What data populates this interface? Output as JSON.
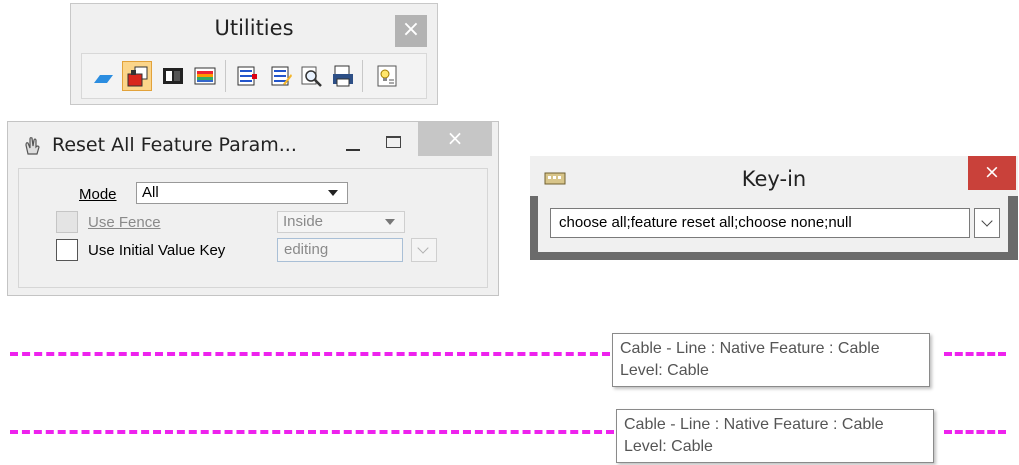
{
  "utilities": {
    "title": "Utilities",
    "close": "×",
    "tools": [
      {
        "icon": "parallelogram-icon"
      },
      {
        "icon": "feature-mode-icon",
        "active": true
      },
      {
        "icon": "panel-icon"
      },
      {
        "icon": "palette-icon"
      },
      {
        "icon": "list-lines-icon"
      },
      {
        "icon": "list-edit-icon"
      },
      {
        "icon": "magnifier-icon"
      },
      {
        "icon": "printer-icon"
      },
      {
        "icon": "bulb-note-icon"
      }
    ]
  },
  "reset_dialog": {
    "title": "Reset All Feature Param...",
    "close": "×",
    "mode_label": "Mode",
    "mode_value": "All",
    "use_fence_label": "Use Fence",
    "fence_value": "Inside",
    "use_initial_label": "Use Initial Value Key",
    "initial_value": "editing"
  },
  "keyin": {
    "title": "Key-in",
    "close": "×",
    "command": "choose all;feature reset all;choose none;null"
  },
  "tooltips": [
    {
      "line1": "Cable - Line : Native Feature : Cable",
      "line2": "Level: Cable"
    },
    {
      "line1": "Cable - Line : Native Feature : Cable",
      "line2": "Level: Cable"
    }
  ],
  "colors": {
    "dash_line": "#ee22ee",
    "close_red": "#c9413a",
    "active_tool": "#fbd58a"
  }
}
